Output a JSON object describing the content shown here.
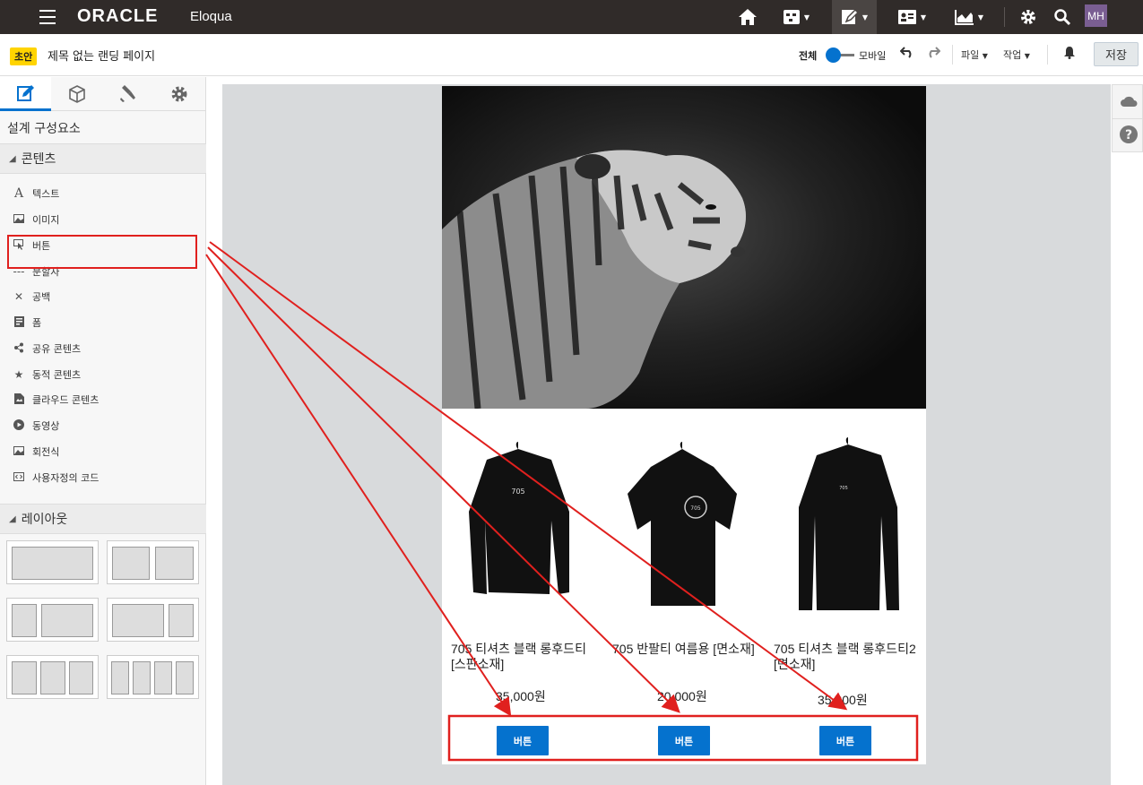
{
  "topbar": {
    "brand": "ORACLE",
    "app_name": "Eloqua",
    "icons": [
      "menu-icon",
      "home-icon",
      "campaigns-icon",
      "assets-icon",
      "contacts-icon",
      "insight-icon",
      "settings-icon",
      "search-icon"
    ],
    "avatar_initials": "MH"
  },
  "subbar": {
    "status_badge": "초안",
    "page_title": "제목 없는 랜딩 페이지",
    "view_full": "전체",
    "view_mobile": "모바일",
    "file_menu": "파일",
    "action_menu": "작업",
    "save_label": "저장"
  },
  "left_panel": {
    "title": "설계 구성요소",
    "content_section": "콘텐츠",
    "items": [
      {
        "label": "텍스트",
        "icon": "text-icon"
      },
      {
        "label": "이미지",
        "icon": "image-icon"
      },
      {
        "label": "버튼",
        "icon": "button-icon"
      },
      {
        "label": "분할자",
        "icon": "divider-icon"
      },
      {
        "label": "공백",
        "icon": "spacer-icon"
      },
      {
        "label": "폼",
        "icon": "form-icon"
      },
      {
        "label": "공유 콘텐츠",
        "icon": "share-icon"
      },
      {
        "label": "동적 콘텐츠",
        "icon": "star-icon"
      },
      {
        "label": "클라우드 콘텐츠",
        "icon": "cloud-content-icon"
      },
      {
        "label": "동영상",
        "icon": "play-icon"
      },
      {
        "label": "회전식",
        "icon": "carousel-icon"
      },
      {
        "label": "사용자정의 코드",
        "icon": "code-icon"
      }
    ],
    "layout_section": "레이아웃"
  },
  "products": [
    {
      "name": "705 티셔츠 블랙 롱후드티  [스판소재]",
      "price": "35,000원",
      "button": "버튼"
    },
    {
      "name": "705 반팔티 여름용 [면소재]",
      "price": "20,000원",
      "button": "버튼"
    },
    {
      "name": "705 티셔츠 블랙 롱후드티2 [면소재]",
      "price": "35,000원",
      "button": "버튼"
    }
  ],
  "colors": {
    "accent": "#0572ce",
    "topbar": "#302b29",
    "annotation": "#e0201e",
    "badge": "#ffd400"
  }
}
